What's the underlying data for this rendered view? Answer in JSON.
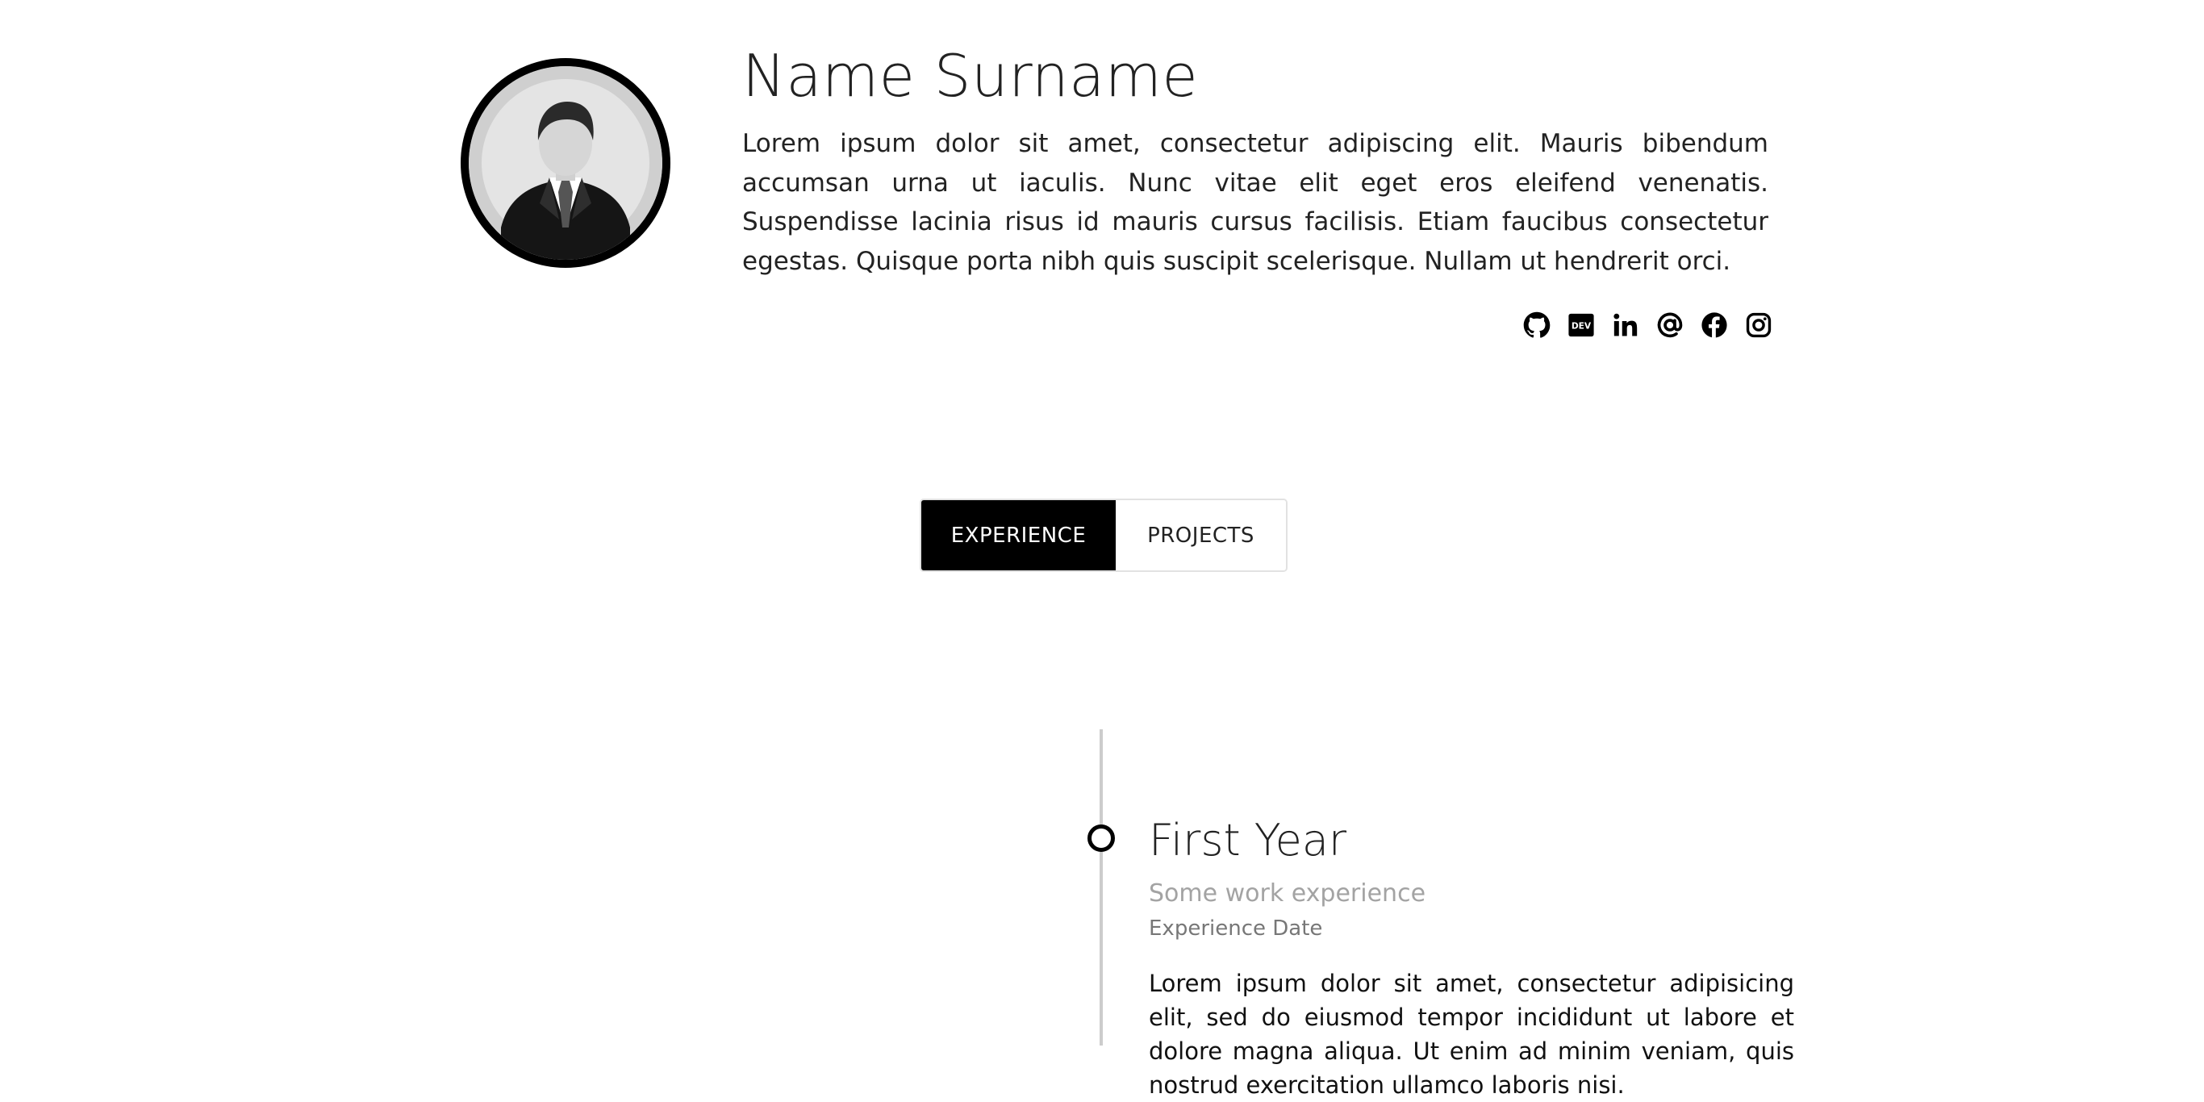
{
  "profile": {
    "name": "Name Surname",
    "bio": "Lorem ipsum dolor sit amet, consectetur adipiscing elit. Mauris bibendum accumsan urna ut iaculis. Nunc vitae elit eget eros eleifend venenatis. Suspendisse lacinia risus id mauris cursus facilisis. Etiam faucibus consectetur egestas. Quisque porta nibh quis suscipit scelerisque. Nullam ut hendrerit orci.",
    "avatar_icon": "person-avatar-icon"
  },
  "socials": [
    {
      "icon": "github-icon"
    },
    {
      "icon": "dev-icon",
      "label": "DEV"
    },
    {
      "icon": "linkedin-icon"
    },
    {
      "icon": "at-sign-icon"
    },
    {
      "icon": "facebook-icon"
    },
    {
      "icon": "instagram-icon"
    }
  ],
  "tabs": [
    {
      "label": "EXPERIENCE",
      "active": true
    },
    {
      "label": "PROJECTS",
      "active": false
    }
  ],
  "timeline": {
    "entries": [
      {
        "title": "First Year",
        "subtitle": "Some work experience",
        "date": "Experience Date",
        "body": "Lorem ipsum dolor sit amet, consectetur adipisicing elit, sed do eiusmod tempor incididunt ut labore et dolore magna aliqua. Ut enim ad minim veniam, quis nostrud exercitation ullamco laboris nisi."
      }
    ]
  },
  "colors": {
    "accent": "#000000",
    "text": "#222222",
    "muted": "#a3a3a3",
    "date": "#777777",
    "timeline_line": "#cccccc",
    "background": "#ffffff"
  }
}
